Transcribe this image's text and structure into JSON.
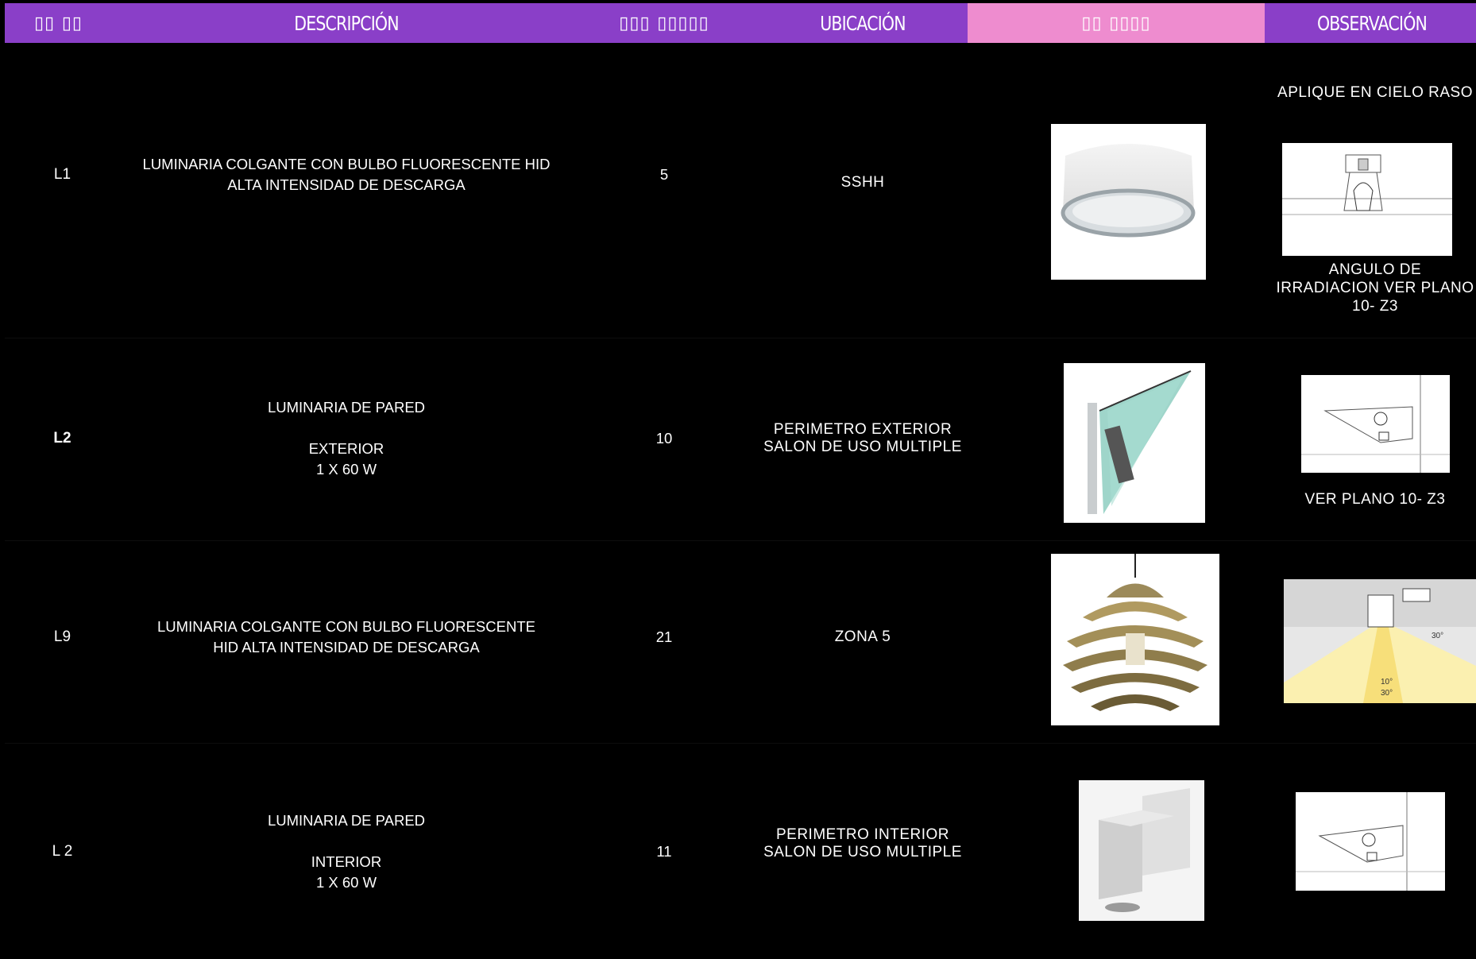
{
  "header": {
    "col_code": "▯▯ ▯▯",
    "col_desc": "DESCRIPCIÓN",
    "col_qty": "▯▯▯ ▯▯▯▯▯",
    "col_loc": "UBICACIÓN",
    "col_img": "▯▯ ▯▯▯▯",
    "col_obs": "OBSERVACIÓN",
    "colors": {
      "purple": "#8a3fc8",
      "pink": "#ee8ccf"
    }
  },
  "rows": [
    {
      "code": "L1",
      "desc_lines": [
        "LUMINARIA  COLGANTE  CON BULBO FLUORESCENTE  HID",
        "ALTA INTENSIDAD DE DESCARGA"
      ],
      "qty": "5",
      "location": "SSHH",
      "obs_top": "APLIQUE EN CIELO RASO",
      "obs_bottom": "ANGULO DE IRRADIACION VER PLANO 10- Z3",
      "icon": "ceiling-downlight"
    },
    {
      "code": "L2",
      "desc_lines": [
        "LUMINARIA  DE PARED",
        "",
        "EXTERIOR",
        "1 X 60 W"
      ],
      "qty": "10",
      "location": "PERIMETRO EXTERIOR SALON DE USO MULTIPLE",
      "obs_bottom": "VER PLANO 10- Z3",
      "icon": "glass-wall-sconce"
    },
    {
      "code": "L9",
      "desc_lines": [
        "LUMINARIA COLGANTE  CON BULBO FLUORESCENTE",
        "HID  ALTA INTENSIDAD DE DESCARGA"
      ],
      "qty": "21",
      "location": "ZONA 5",
      "diagram_labels": [
        "30°",
        "10°",
        "30°"
      ],
      "icon": "pendant-lamp"
    },
    {
      "code": "L 2",
      "desc_lines": [
        "LUMINARIA  DE PARED",
        "",
        "INTERIOR",
        "1 X 60 W"
      ],
      "qty": "11",
      "location": "PERIMETRO INTERIOR SALON DE USO MULTIPLE",
      "icon": "cube-wall-light"
    }
  ]
}
